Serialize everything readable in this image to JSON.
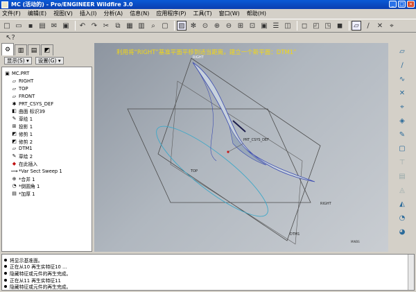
{
  "window": {
    "title": "MC (活动的) - Pro/ENGINEER Wildfire 3.0"
  },
  "menu": [
    "文件(F)",
    "编辑(E)",
    "视图(V)",
    "插入(I)",
    "分析(A)",
    "信息(N)",
    "应用程序(P)",
    "工具(T)",
    "窗口(W)",
    "帮助(H)"
  ],
  "nav": {
    "show_label": "显示(S) ▾",
    "settings_label": "设置(G) ▾"
  },
  "tree": [
    {
      "label": "MC.PRT",
      "icon": "part-icon",
      "indent": 0
    },
    {
      "label": "RIGHT",
      "icon": "datum-plane-icon",
      "indent": 1
    },
    {
      "label": "TOP",
      "icon": "datum-plane-icon",
      "indent": 1
    },
    {
      "label": "FRONT",
      "icon": "datum-plane-icon",
      "indent": 1
    },
    {
      "label": "PRT_CSYS_DEF",
      "icon": "csys-icon",
      "indent": 1
    },
    {
      "label": "曲面 标识39",
      "icon": "surface-icon",
      "indent": 1
    },
    {
      "label": "草绘 1",
      "icon": "sketch-icon",
      "indent": 1
    },
    {
      "label": "投影 1",
      "icon": "projection-icon",
      "indent": 1
    },
    {
      "label": "修剪 1",
      "icon": "trim-icon",
      "indent": 1
    },
    {
      "label": "修剪 2",
      "icon": "trim-icon",
      "indent": 1
    },
    {
      "label": "DTM1",
      "icon": "datum-plane-icon",
      "indent": 1
    },
    {
      "label": "草绘 2",
      "icon": "sketch-icon",
      "indent": 1
    },
    {
      "label": "在此插入",
      "icon": "insert-here-icon",
      "indent": 1
    },
    {
      "label": "*Var Sect Sweep 1",
      "icon": "sweep-icon",
      "indent": 1
    },
    {
      "label": "*合并 1",
      "icon": "merge-icon",
      "indent": 1
    },
    {
      "label": "*倒圆角 1",
      "icon": "round-icon",
      "indent": 1
    },
    {
      "label": "*加厚 1",
      "icon": "thicken-icon",
      "indent": 1
    }
  ],
  "viewport": {
    "message": "利用将“RIGHT”基准平面平移到适当距离，建立一个新平面：DTM1”",
    "labels": {
      "right": "RIGHT",
      "top": "TOP",
      "dtm1": "DTM1",
      "csys": "PRT_CSYS_DEF",
      "corner": "MWBS",
      "topleft": "RIGHT"
    }
  },
  "messages": [
    "将显示基准面。",
    "正在从10 再生实特征10 ...",
    "隐藏特征或元件的再生完成。",
    "正在从11 再生实特征11",
    "隐藏特征或元件的再生完成。"
  ],
  "colors": {
    "title": "#0a4fcc",
    "message_yellow": "#f4d812",
    "surface": "#c8d2dc",
    "edge_blue": "#3a4ab0"
  }
}
